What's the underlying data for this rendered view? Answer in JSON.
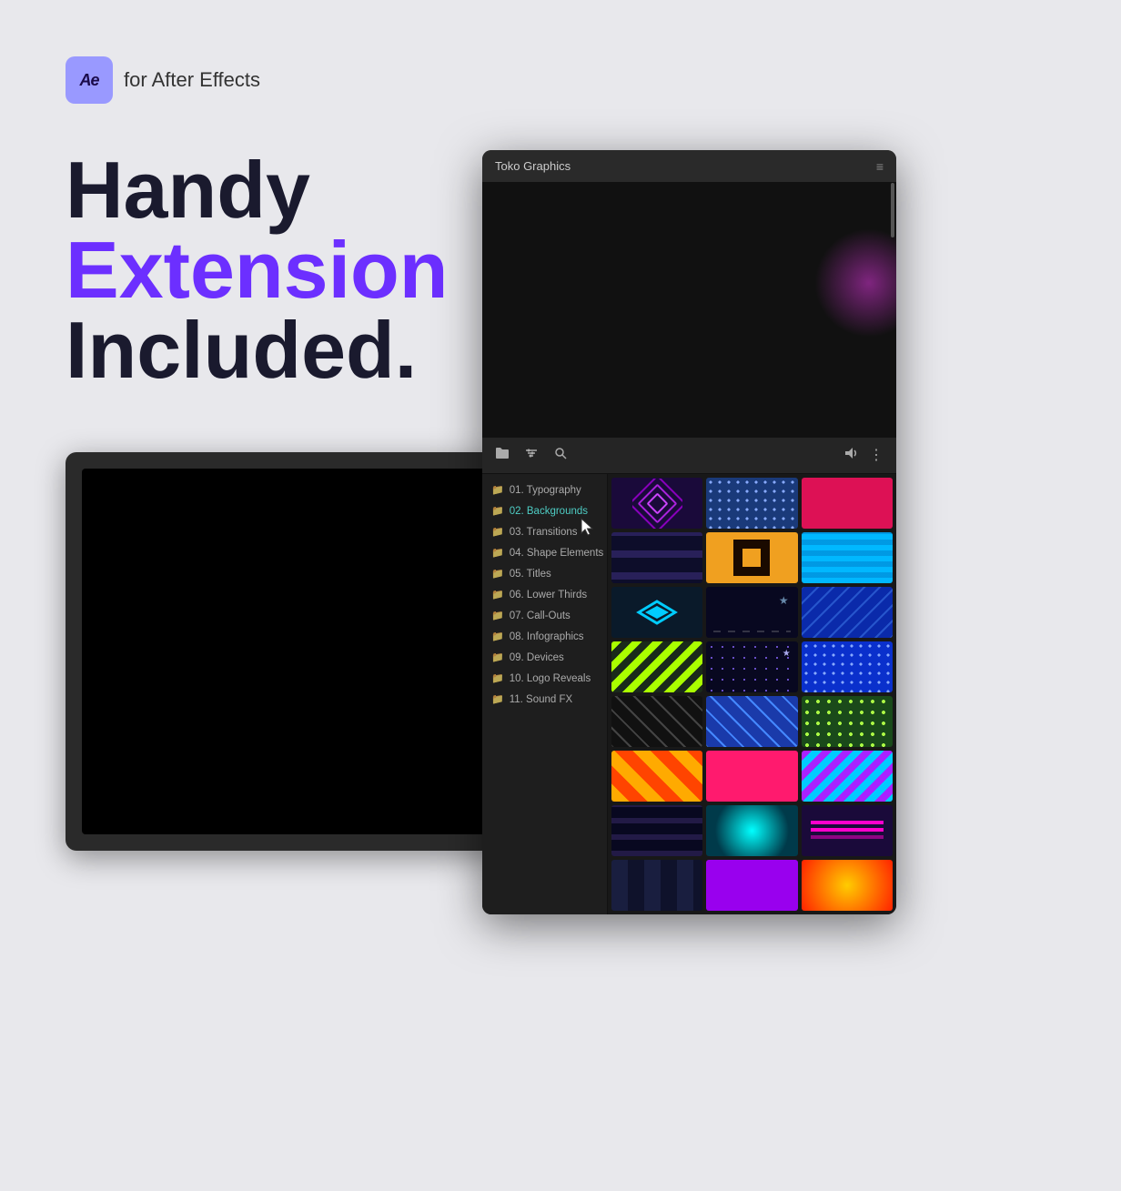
{
  "ae_badge": {
    "icon_text": "Ae",
    "label": "for After Effects"
  },
  "headline": {
    "line1": "Handy",
    "line2": "Extension",
    "line3": "Included."
  },
  "panel": {
    "title": "Toko Graphics",
    "menu_icon": "≡",
    "toolbar": {
      "folder_icon": "🗀",
      "filter_icon": "⊟",
      "search_icon": "🔍",
      "speaker_icon": "🔊",
      "more_icon": "⋮"
    },
    "sidebar_items": [
      {
        "id": 1,
        "label": "01. Typography",
        "active": false
      },
      {
        "id": 2,
        "label": "02. Backgrounds",
        "active": true
      },
      {
        "id": 3,
        "label": "03. Transitions",
        "active": false
      },
      {
        "id": 4,
        "label": "04. Shape Elements",
        "active": false
      },
      {
        "id": 5,
        "label": "05. Titles",
        "active": false
      },
      {
        "id": 6,
        "label": "06. Lower Thirds",
        "active": false
      },
      {
        "id": 7,
        "label": "07. Call-Outs",
        "active": false
      },
      {
        "id": 8,
        "label": "08. Infographics",
        "active": false
      },
      {
        "id": 9,
        "label": "09. Devices",
        "active": false
      },
      {
        "id": 10,
        "label": "10. Logo Reveals",
        "active": false
      },
      {
        "id": 11,
        "label": "11. Sound FX",
        "active": false
      }
    ]
  }
}
